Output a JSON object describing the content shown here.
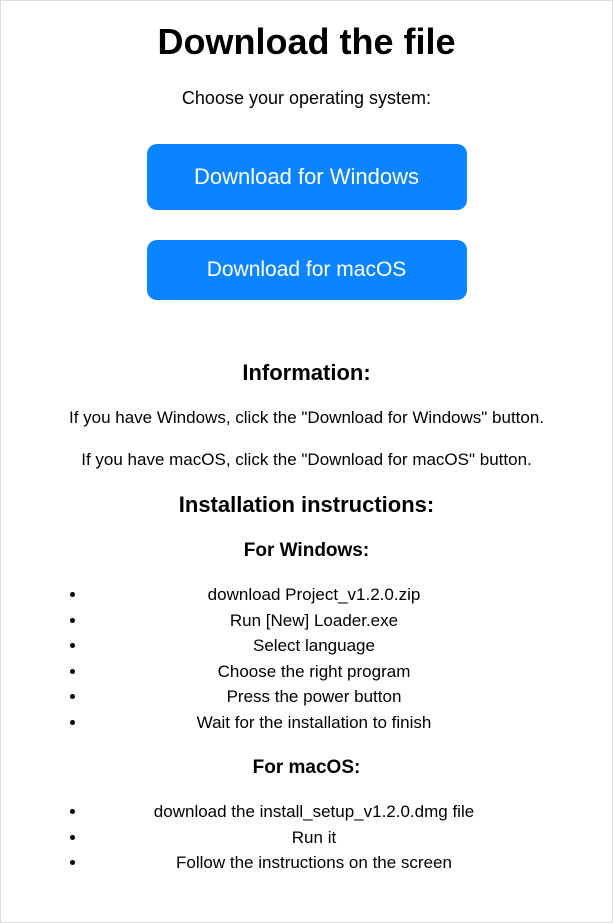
{
  "title": "Download the file",
  "subtitle": "Choose your operating system:",
  "buttons": {
    "windows": "Download for Windows",
    "macos": "Download for macOS"
  },
  "info": {
    "heading": "Information:",
    "windows_text": "If you have Windows, click the \"Download for Windows\" button.",
    "macos_text": "If you have macOS, click the \"Download for macOS\" button."
  },
  "install": {
    "heading": "Installation instructions:",
    "windows": {
      "heading": "For Windows:",
      "steps": [
        "download Project_v1.2.0.zip",
        "Run [New] Loader.exe",
        "Select language",
        "Choose the right program",
        "Press the power button",
        "Wait for the installation to finish"
      ]
    },
    "macos": {
      "heading": "For macOS:",
      "steps": [
        "download the install_setup_v1.2.0.dmg file",
        "Run it",
        "Follow the instructions on the screen"
      ]
    }
  }
}
